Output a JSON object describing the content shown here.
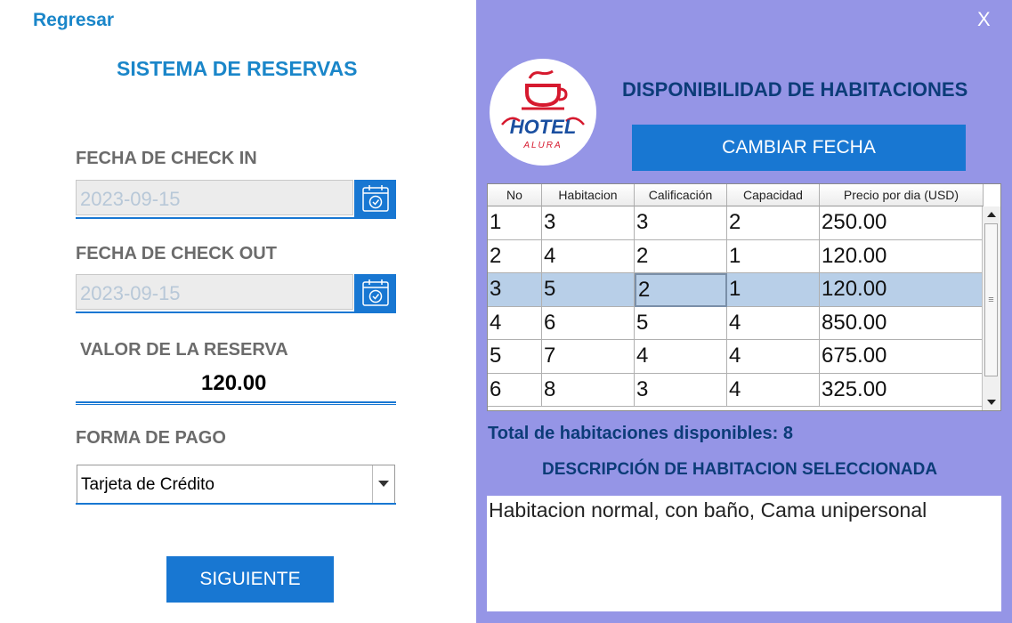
{
  "left": {
    "back_label": "Regresar",
    "title": "SISTEMA DE RESERVAS",
    "checkin_label": "FECHA DE CHECK IN",
    "checkin_value": "2023-09-15",
    "checkout_label": "FECHA DE CHECK OUT",
    "checkout_value": "2023-09-15",
    "valor_label": "VALOR DE LA RESERVA",
    "valor_value": "120.00",
    "pago_label": "FORMA DE PAGO",
    "pago_value": "Tarjeta de Crédito",
    "next_label": "SIGUIENTE"
  },
  "right": {
    "close_label": "X",
    "logo_text": "HOTEL",
    "logo_subtext": "ALURA",
    "title": "DISPONIBILIDAD DE HABITACIONES",
    "change_date_label": "CAMBIAR FECHA",
    "table": {
      "columns": [
        "No",
        "Habitacion",
        "Calificación",
        "Capacidad",
        "Precio por dia (USD)"
      ],
      "rows": [
        [
          "1",
          "3",
          "3",
          "2",
          "250.00"
        ],
        [
          "2",
          "4",
          "2",
          "1",
          "120.00"
        ],
        [
          "3",
          "5",
          "2",
          "1",
          "120.00"
        ],
        [
          "4",
          "6",
          "5",
          "4",
          "850.00"
        ],
        [
          "5",
          "7",
          "4",
          "4",
          "675.00"
        ],
        [
          "6",
          "8",
          "3",
          "4",
          "325.00"
        ]
      ],
      "selected_row": 2
    },
    "total_label": "Total de habitaciones disponibles: 8",
    "desc_title": "DESCRIPCIÓN DE HABITACION SELECCIONADA",
    "desc_text": "Habitacion normal, con baño, Cama unipersonal"
  },
  "colors": {
    "accent": "#1877d2",
    "panel": "#9595e6",
    "heading_blue": "#1a86c9",
    "dark_navy": "#0c3c78",
    "selection": "#b8cfe8"
  },
  "icons": [
    "calendar-icon",
    "dropdown-arrow-icon",
    "close-icon",
    "scroll-up-icon",
    "scroll-down-icon"
  ]
}
